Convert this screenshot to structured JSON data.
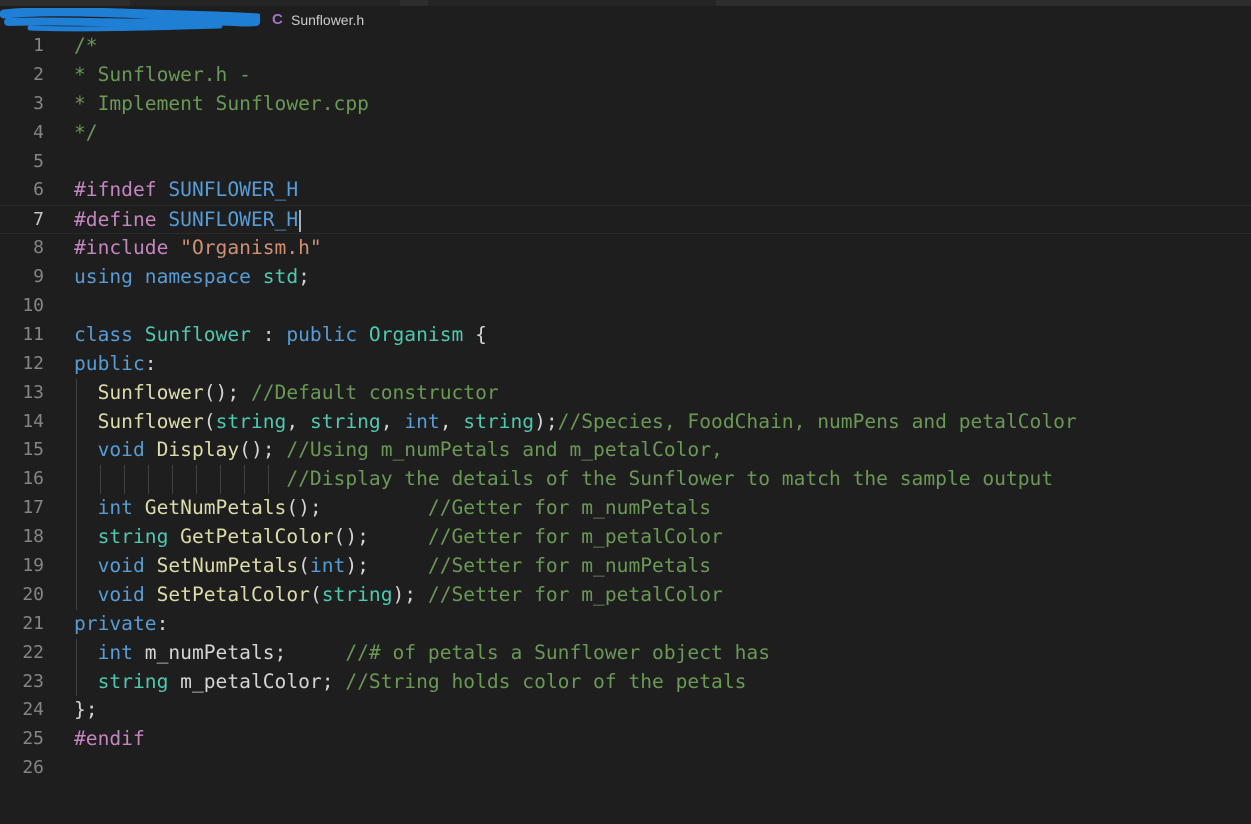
{
  "breadcrumb": {
    "file_icon": "C",
    "file_name": "Sunflower.h"
  },
  "colors": {
    "background": "#1e1e1e",
    "comment": "#6a9955",
    "keyword": "#569cd6",
    "type": "#4ec9b0",
    "function": "#dcdcaa",
    "string": "#ce9178",
    "directive": "#c586c0",
    "line_number": "#858585"
  },
  "editor": {
    "current_line": 7,
    "lines": [
      {
        "n": "1",
        "code": "/*"
      },
      {
        "n": "2",
        "code": "* Sunflower.h -"
      },
      {
        "n": "3",
        "code": "* Implement Sunflower.cpp"
      },
      {
        "n": "4",
        "code": "*/"
      },
      {
        "n": "5",
        "code": ""
      },
      {
        "n": "6",
        "code": "#ifndef SUNFLOWER_H"
      },
      {
        "n": "7",
        "code": "#define SUNFLOWER_H"
      },
      {
        "n": "8",
        "code": "#include \"Organism.h\""
      },
      {
        "n": "9",
        "code": "using namespace std;"
      },
      {
        "n": "10",
        "code": ""
      },
      {
        "n": "11",
        "code": "class Sunflower : public Organism {"
      },
      {
        "n": "12",
        "code": "public:"
      },
      {
        "n": "13",
        "code": "  Sunflower(); //Default constructor"
      },
      {
        "n": "14",
        "code": "  Sunflower(string, string, int, string);//Species, FoodChain, numPens and petalColor"
      },
      {
        "n": "15",
        "code": "  void Display(); //Using m_numPetals and m_petalColor,"
      },
      {
        "n": "16",
        "code": "                  //Display the details of the Sunflower to match the sample output"
      },
      {
        "n": "17",
        "code": "  int GetNumPetals();         //Getter for m_numPetals"
      },
      {
        "n": "18",
        "code": "  string GetPetalColor();     //Getter for m_petalColor"
      },
      {
        "n": "19",
        "code": "  void SetNumPetals(int);     //Setter for m_numPetals"
      },
      {
        "n": "20",
        "code": "  void SetPetalColor(string); //Setter for m_petalColor"
      },
      {
        "n": "21",
        "code": "private:"
      },
      {
        "n": "22",
        "code": "  int m_numPetals;     //# of petals a Sunflower object has"
      },
      {
        "n": "23",
        "code": "  string m_petalColor; //String holds color of the petals"
      },
      {
        "n": "24",
        "code": "};"
      },
      {
        "n": "25",
        "code": "#endif"
      },
      {
        "n": "26",
        "code": ""
      }
    ]
  }
}
